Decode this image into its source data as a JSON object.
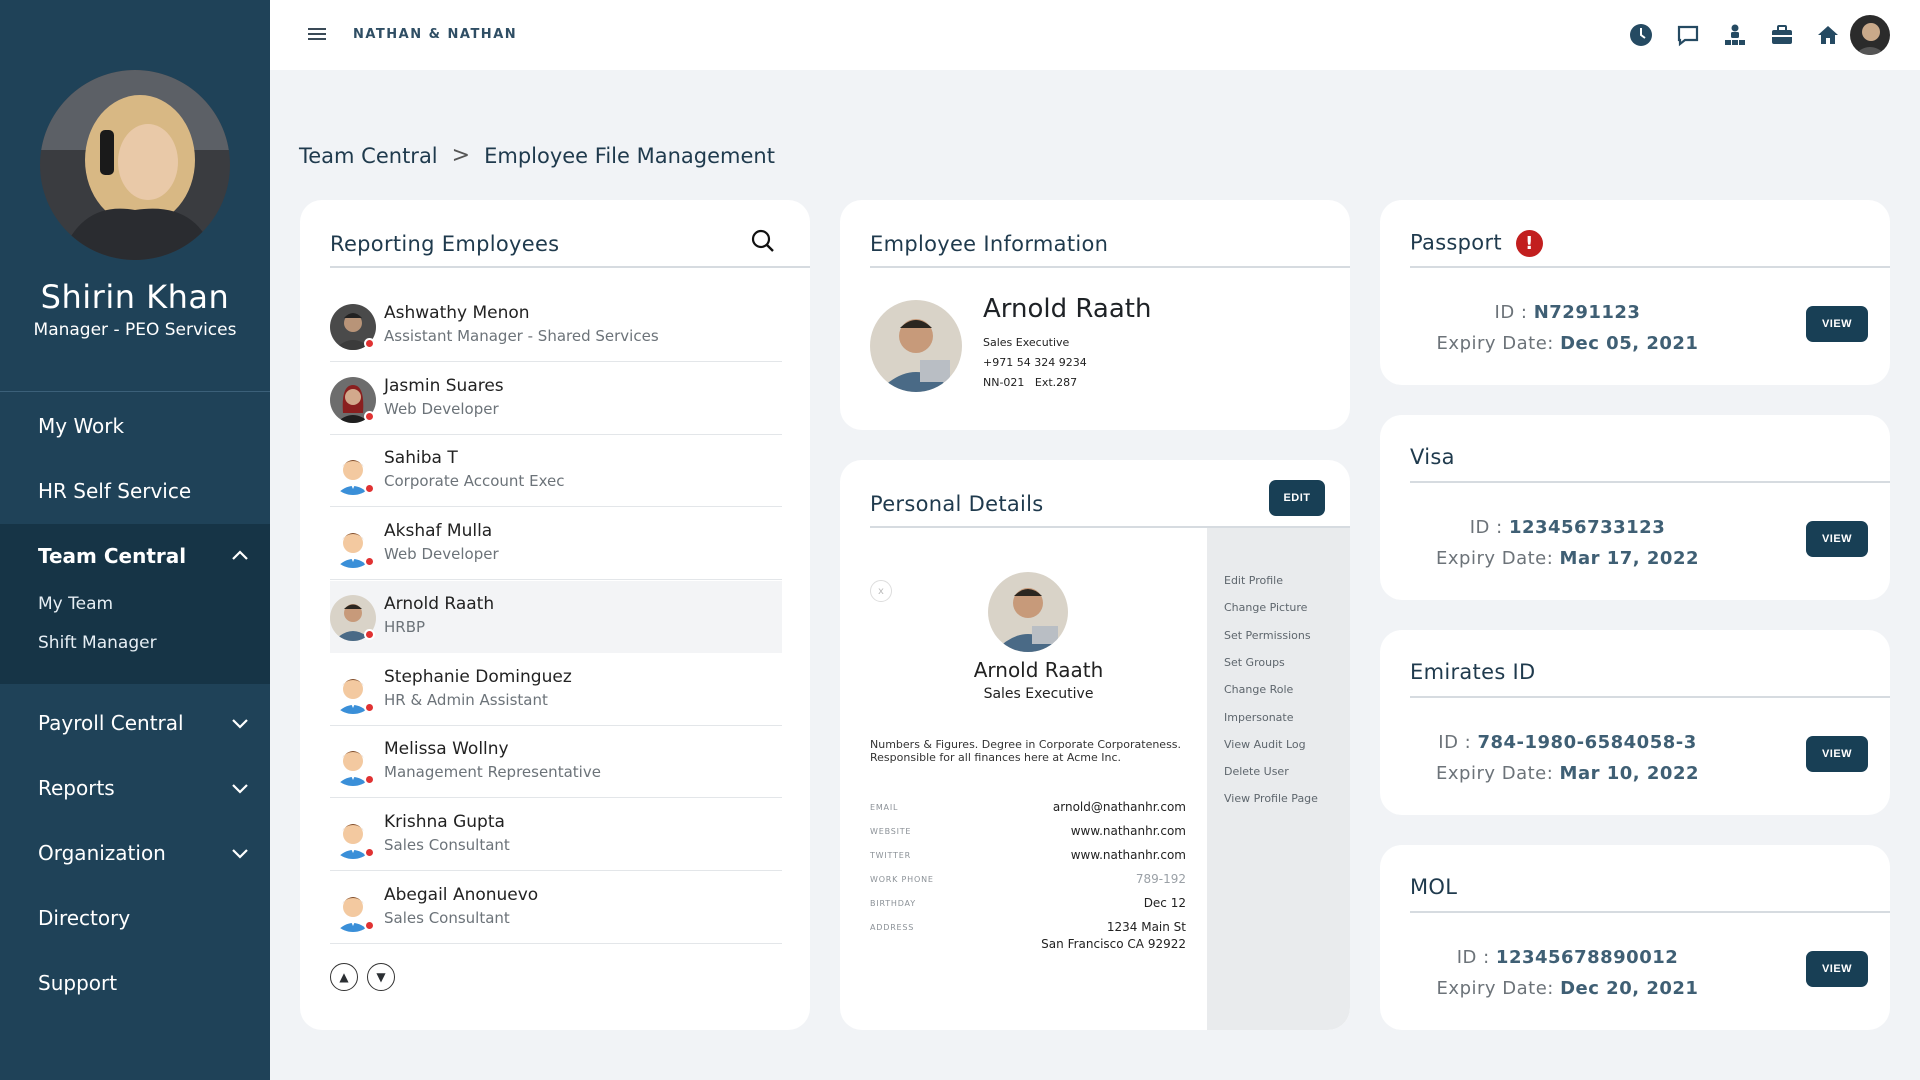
{
  "topbar": {
    "brand": "NATHAN & NATHAN",
    "icons": [
      "clock-icon",
      "chat-icon",
      "org-chart-icon",
      "briefcase-icon",
      "home-icon"
    ]
  },
  "sidebar": {
    "user_name": "Shirin Khan",
    "user_role": "Manager - PEO Services",
    "items": [
      {
        "label": "My Work"
      },
      {
        "label": "HR Self Service"
      },
      {
        "label": "Team Central",
        "expanded": true,
        "children": [
          {
            "label": "My Team"
          },
          {
            "label": "Shift Manager"
          }
        ]
      },
      {
        "label": "Payroll Central"
      },
      {
        "label": "Reports"
      },
      {
        "label": "Organization"
      },
      {
        "label": "Directory"
      },
      {
        "label": "Support"
      }
    ]
  },
  "breadcrumb": {
    "parent": "Team Central",
    "separator": ">",
    "current": "Employee File Management"
  },
  "reporting": {
    "title": "Reporting Employees",
    "employees": [
      {
        "name": "Ashwathy Menon",
        "role": "Assistant Manager - Shared Services"
      },
      {
        "name": "Jasmin Suares",
        "role": "Web Developer"
      },
      {
        "name": "Sahiba T",
        "role": "Corporate Account Exec"
      },
      {
        "name": "Akshaf Mulla",
        "role": "Web Developer"
      },
      {
        "name": "Arnold Raath",
        "role": "HRBP"
      },
      {
        "name": "Stephanie Dominguez",
        "role": "HR & Admin Assistant"
      },
      {
        "name": "Melissa Wollny",
        "role": "Management Representative"
      },
      {
        "name": "Krishna Gupta",
        "role": "Sales Consultant"
      },
      {
        "name": "Abegail Anonuevo",
        "role": "Sales Consultant"
      }
    ],
    "pager_up": "▲",
    "pager_down": "▼"
  },
  "employee_info": {
    "title": "Employee Information",
    "name": "Arnold Raath",
    "position": "Sales Executive",
    "phone": "+971 54 324 9234",
    "code": "NN-021   Ext.287"
  },
  "personal": {
    "title": "Personal Details",
    "edit_label": "EDIT",
    "close_label": "x",
    "name": "Arnold Raath",
    "position": "Sales Executive",
    "bio_line1": "Numbers & Figures. Degree in Corporate Corporateness.",
    "bio_line2": "Responsible for all finances here at Acme Inc.",
    "fields": [
      {
        "label": "EMAIL",
        "value": "arnold@nathanhr.com"
      },
      {
        "label": "WEBSITE",
        "value": "www.nathanhr.com"
      },
      {
        "label": "TWITTER",
        "value": "www.nathanhr.com"
      },
      {
        "label": "WORK PHONE",
        "value": "789-192"
      },
      {
        "label": "BIRTHDAY",
        "value": "Dec 12"
      },
      {
        "label": "ADDRESS",
        "value": "1234 Main St",
        "value2": "San Francisco CA 92922"
      }
    ],
    "menu": [
      "Edit Profile",
      "Change Picture",
      "Set Permissions",
      "Set Groups",
      "Change Role",
      "Impersonate",
      "View Audit Log",
      "Delete User",
      "View Profile Page"
    ]
  },
  "documents": [
    {
      "title": "Passport",
      "alert": "!",
      "id_label": "ID : ",
      "id": "N7291123",
      "exp_label": "Expiry Date: ",
      "exp": "Dec 05, 2021",
      "button": "VIEW"
    },
    {
      "title": "Visa",
      "id_label": "ID : ",
      "id": "123456733123",
      "exp_label": "Expiry Date: ",
      "exp": "Mar 17, 2022",
      "button": "VIEW"
    },
    {
      "title": "Emirates ID",
      "id_label": "ID : ",
      "id": "784-1980-6584058-3",
      "exp_label": "Expiry Date: ",
      "exp": "Mar 10, 2022",
      "button": "VIEW"
    },
    {
      "title": "MOL",
      "id_label": "ID : ",
      "id": "12345678890012",
      "exp_label": "Expiry Date: ",
      "exp": "Dec 20, 2021",
      "button": "VIEW"
    }
  ]
}
